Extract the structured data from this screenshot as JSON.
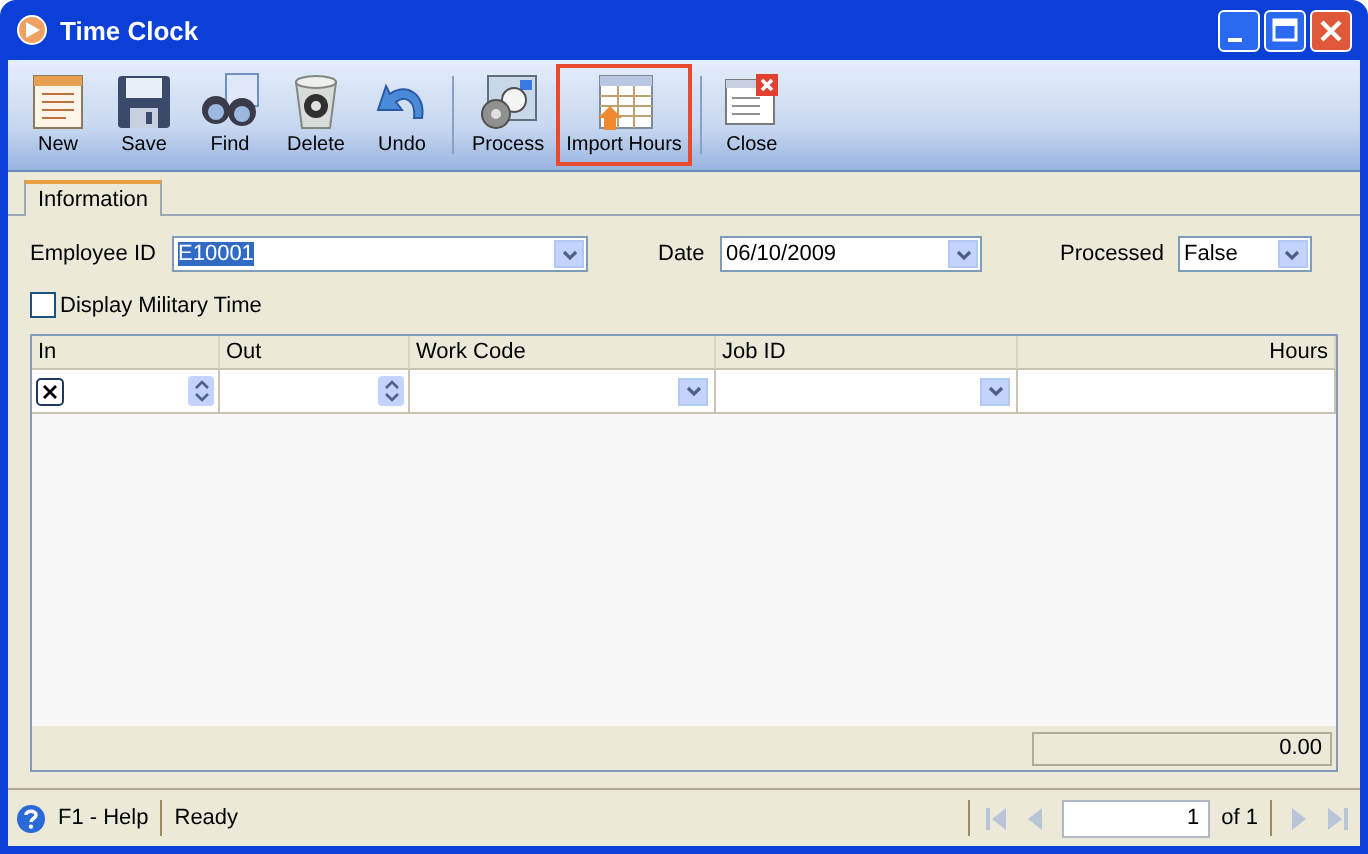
{
  "window": {
    "title": "Time Clock"
  },
  "toolbar": {
    "groups": [
      [
        {
          "label": "New",
          "highlighted": false
        },
        {
          "label": "Save",
          "highlighted": false
        },
        {
          "label": "Find",
          "highlighted": false
        },
        {
          "label": "Delete",
          "highlighted": false
        },
        {
          "label": "Undo",
          "highlighted": false
        }
      ],
      [
        {
          "label": "Process",
          "highlighted": false
        },
        {
          "label": "Import Hours",
          "highlighted": true
        }
      ],
      [
        {
          "label": "Close",
          "highlighted": false
        }
      ]
    ]
  },
  "tabs": [
    {
      "label": "Information",
      "selected": true
    }
  ],
  "fields": [
    {
      "label": "Employee ID",
      "value": "E10001",
      "text_selected": true
    },
    {
      "label": "Date",
      "value": "06/10/2009",
      "text_selected": false
    },
    {
      "label": "Processed",
      "value": "False",
      "text_selected": false
    }
  ],
  "military_time": {
    "label": "Display Military Time",
    "checked": false
  },
  "grid": {
    "columns": [
      {
        "label": "In",
        "kind": "spin"
      },
      {
        "label": "Out",
        "kind": "spin"
      },
      {
        "label": "Work Code",
        "kind": "dropdown"
      },
      {
        "label": "Job ID",
        "kind": "dropdown"
      },
      {
        "label": "Hours",
        "kind": "number"
      }
    ],
    "total": "0.00"
  },
  "status_bar": {
    "help": "F1 - Help",
    "status": "Ready",
    "page": "1",
    "page_count": "of 1"
  }
}
